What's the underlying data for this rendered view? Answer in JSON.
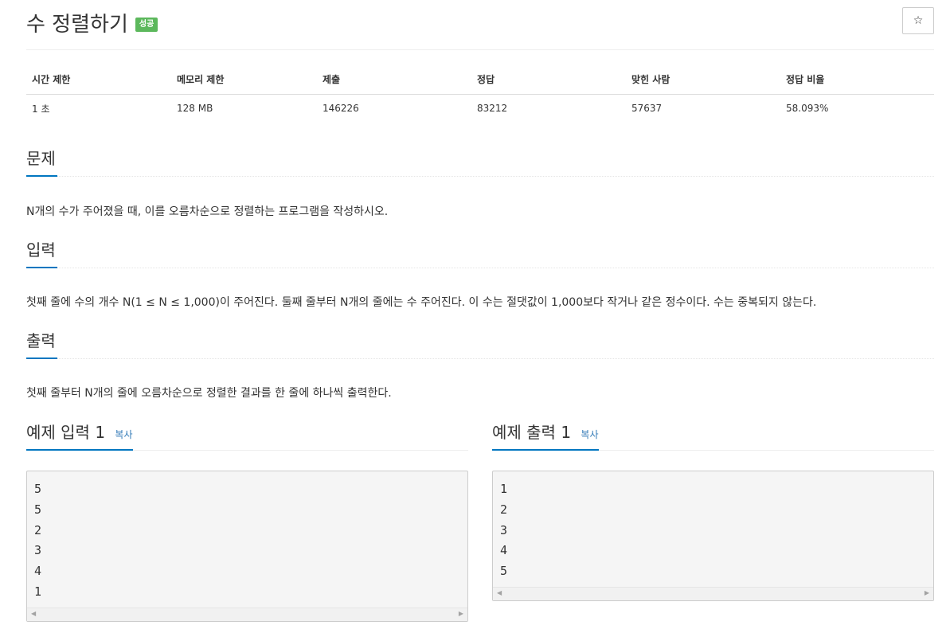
{
  "problem": {
    "title": "수 정렬하기",
    "badge": "성공",
    "star_icon": "☆"
  },
  "info_table": {
    "headers": [
      "시간 제한",
      "메모리 제한",
      "제출",
      "정답",
      "맞힌 사람",
      "정답 비율"
    ],
    "values": [
      "1 초",
      "128 MB",
      "146226",
      "83212",
      "57637",
      "58.093%"
    ]
  },
  "sections": {
    "description": {
      "heading": "문제",
      "text": "N개의 수가 주어졌을 때, 이를 오름차순으로 정렬하는 프로그램을 작성하시오."
    },
    "input": {
      "heading": "입력",
      "text": "첫째 줄에 수의 개수 N(1 ≤ N ≤ 1,000)이 주어진다. 둘째 줄부터 N개의 줄에는 수 주어진다. 이 수는 절댓값이 1,000보다 작거나 같은 정수이다. 수는 중복되지 않는다."
    },
    "output": {
      "heading": "출력",
      "text": "첫째 줄부터 N개의 줄에 오름차순으로 정렬한 결과를 한 줄에 하나씩 출력한다."
    }
  },
  "examples": {
    "input": {
      "heading": "예제 입력 1",
      "copy_label": "복사",
      "lines": [
        "5",
        "5",
        "2",
        "3",
        "4",
        "1"
      ]
    },
    "output": {
      "heading": "예제 출력 1",
      "copy_label": "복사",
      "lines": [
        "1",
        "2",
        "3",
        "4",
        "5"
      ]
    }
  },
  "colors": {
    "accent": "#0076c0",
    "success": "#5cb85c",
    "link": "#337ab7"
  }
}
